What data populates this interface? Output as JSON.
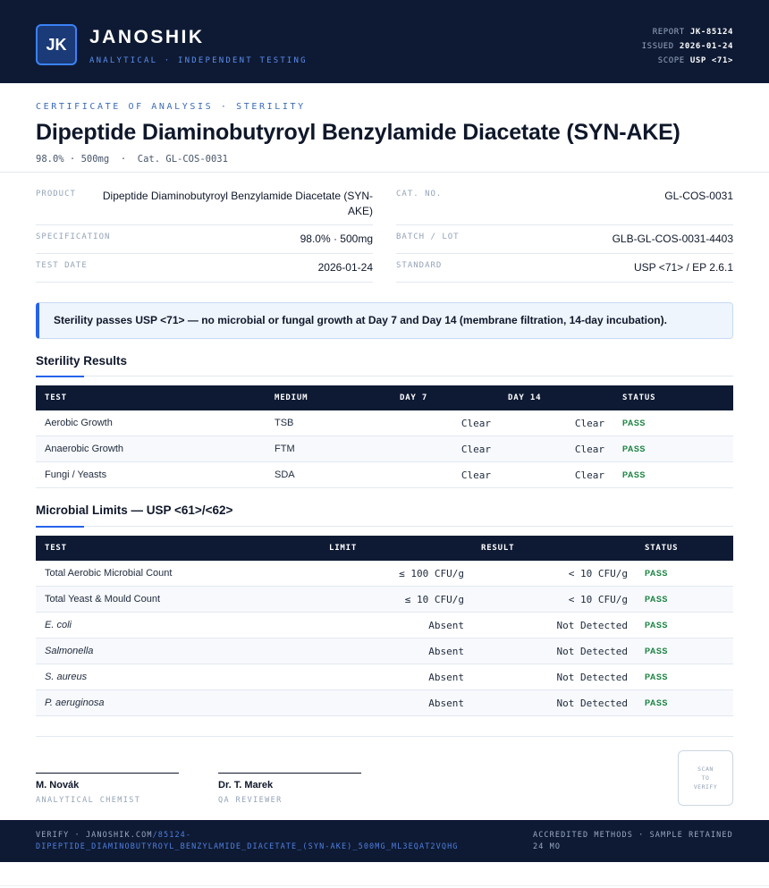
{
  "header": {
    "logo": "JK",
    "brand": "JANOSHIK",
    "tagline": "ANALYTICAL · INDEPENDENT TESTING",
    "report_label": "REPORT",
    "report_value": "JK-85124",
    "issued_label": "ISSUED",
    "issued_value": "2026-01-24",
    "scope_label": "SCOPE",
    "scope_value": "USP <71>"
  },
  "cert": {
    "label": "CERTIFICATE OF ANALYSIS · STERILITY",
    "title": "Dipeptide Diaminobutyroyl Benzylamide Diacetate (SYN-AKE)",
    "subline": "98.0% · 500mg  ·  Cat. GL-COS-0031"
  },
  "info": {
    "product_label": "PRODUCT",
    "product_value": "Dipeptide Diaminobutyroyl Benzylamide Diacetate (SYN-AKE)",
    "spec_label": "SPECIFICATION",
    "spec_value": "98.0% · 500mg",
    "date_label": "TEST DATE",
    "date_value": "2026-01-24",
    "cat_label": "CAT. NO.",
    "cat_value": "GL-COS-0031",
    "batch_label": "BATCH / LOT",
    "batch_value": "GLB-GL-COS-0031-4403",
    "standard_label": "STANDARD",
    "standard_value": "USP <71> / EP 2.6.1"
  },
  "banner": "Sterility passes USP <71> — no microbial or fungal growth at Day 7 and Day 14 (membrane filtration, 14-day incubation).",
  "sterility": {
    "title": "Sterility Results",
    "headers": [
      "TEST",
      "MEDIUM",
      "DAY 7",
      "DAY 14",
      "STATUS"
    ],
    "rows": [
      {
        "test": "Aerobic Growth",
        "medium": "TSB",
        "day7": "Clear",
        "day14": "Clear",
        "status": "PASS"
      },
      {
        "test": "Anaerobic Growth",
        "medium": "FTM",
        "day7": "Clear",
        "day14": "Clear",
        "status": "PASS"
      },
      {
        "test": "Fungi / Yeasts",
        "medium": "SDA",
        "day7": "Clear",
        "day14": "Clear",
        "status": "PASS"
      }
    ]
  },
  "microbial": {
    "title": "Microbial Limits — USP <61>/<62>",
    "headers": [
      "TEST",
      "LIMIT",
      "RESULT",
      "STATUS"
    ],
    "rows": [
      {
        "test": "Total Aerobic Microbial Count",
        "limit": "≤ 100 CFU/g",
        "result": "< 10 CFU/g",
        "status": "PASS"
      },
      {
        "test": "Total Yeast & Mould Count",
        "limit": "≤ 10 CFU/g",
        "result": "< 10 CFU/g",
        "status": "PASS"
      },
      {
        "test": "E. coli",
        "limit": "Absent",
        "result": "Not Detected",
        "status": "PASS"
      },
      {
        "test": "Salmonella",
        "limit": "Absent",
        "result": "Not Detected",
        "status": "PASS"
      },
      {
        "test": "S. aureus",
        "limit": "Absent",
        "result": "Not Detected",
        "status": "PASS"
      },
      {
        "test": "P. aeruginosa",
        "limit": "Absent",
        "result": "Not Detected",
        "status": "PASS"
      }
    ]
  },
  "signatures": [
    {
      "name": "M. Novák",
      "role": "ANALYTICAL CHEMIST"
    },
    {
      "name": "Dr. T. Marek",
      "role": "QA REVIEWER"
    }
  ],
  "qr": {
    "line1": "SCAN",
    "line2": "TO",
    "line3": "VERIFY"
  },
  "footer": {
    "verify_prefix": "VERIFY · JANOSHIK.COM",
    "verify_url": "/85124-DIPEPTIDE_DIAMINOBUTYROYL_BENZYLAMIDE_DIACETATE_(SYN-AKE)_500MG_ML3EQAT2VQHG",
    "right": "ACCREDITED METHODS · SAMPLE RETAINED 24 MO"
  }
}
